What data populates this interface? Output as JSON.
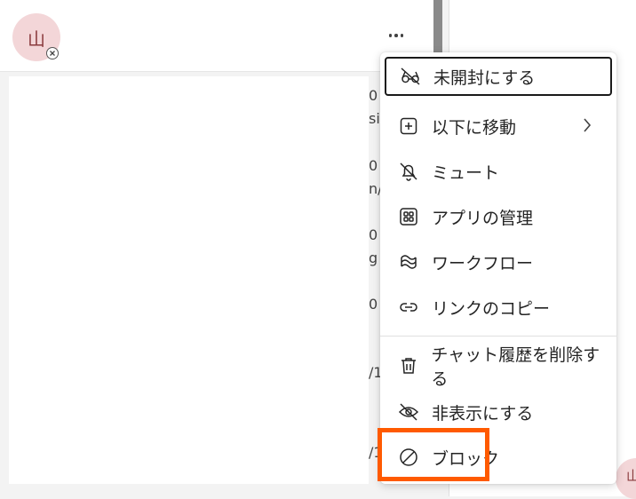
{
  "chat": {
    "avatar_initial": "山",
    "more_label": "..."
  },
  "corner_avatar_initial": "山",
  "clipped_fragments": [
    "0",
    "sis",
    "0",
    "n/",
    "0",
    "g",
    "0",
    "/1",
    "/1"
  ],
  "menu": {
    "items": [
      {
        "label": "未開封にする",
        "icon": "eye-off-glasses-icon"
      },
      {
        "label": "以下に移動",
        "icon": "plus-square-icon",
        "submenu": true
      },
      {
        "label": "ミュート",
        "icon": "bell-off-icon"
      },
      {
        "label": "アプリの管理",
        "icon": "apps-grid-icon"
      },
      {
        "label": "ワークフロー",
        "icon": "workflow-icon"
      },
      {
        "label": "リンクのコピー",
        "icon": "link-icon"
      },
      {
        "label": "チャット履歴を削除する",
        "icon": "trash-icon"
      },
      {
        "label": "非表示にする",
        "icon": "eye-hide-icon"
      },
      {
        "label": "ブロック",
        "icon": "block-icon"
      }
    ]
  },
  "colors": {
    "highlight": "#ff5a00",
    "avatar_bg": "#f3d6d8",
    "focus_border": "#1a1a1a"
  }
}
